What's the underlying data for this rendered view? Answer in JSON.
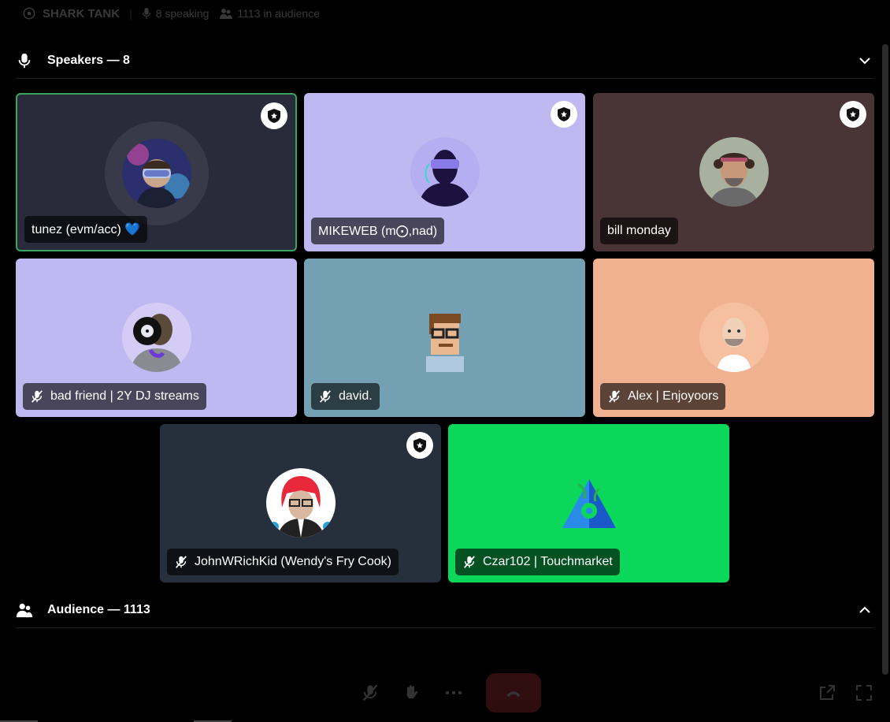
{
  "stage": {
    "title": "SHARK TANK",
    "speaking_text": "8 speaking",
    "audience_text": "1113 in audience"
  },
  "speakers_section": {
    "title": "Speakers — 8",
    "icon": "microphone-icon",
    "chevron": "chevron-down-icon"
  },
  "audience_section": {
    "title": "Audience — 1113",
    "icon": "audience-icon",
    "chevron": "chevron-up-icon"
  },
  "speakers": [
    {
      "name": "tunez (evm/acc) 💙",
      "bg": "#292a3a",
      "moderator": true,
      "muted": false,
      "speaking": true,
      "avatar": "vr-headset-person-avatar"
    },
    {
      "name": "MIKEWEB (m⨀,nad)",
      "bg": "#c0b8f0",
      "moderator": true,
      "muted": false,
      "speaking": false,
      "avatar": "purple-silhouette-avatar"
    },
    {
      "name": "bill monday",
      "bg": "#4a3536",
      "moderator": true,
      "muted": false,
      "speaking": false,
      "avatar": "curly-hair-man-avatar"
    },
    {
      "name": "bad friend | 2Y DJ streams",
      "bg": "#c0b8f0",
      "moderator": false,
      "muted": true,
      "speaking": false,
      "avatar": "vinyl-hoodie-avatar"
    },
    {
      "name": "david.",
      "bg": "#74a0b4",
      "moderator": false,
      "muted": true,
      "speaking": false,
      "avatar": "pixel-man-glasses-avatar"
    },
    {
      "name": "Alex | Enjoyoors",
      "bg": "#efb190",
      "moderator": false,
      "muted": true,
      "speaking": false,
      "avatar": "bald-bearded-cartoon-avatar"
    },
    {
      "name": "JohnWRichKid (Wendy's Fry Cook)",
      "bg": "#25303c",
      "moderator": true,
      "muted": true,
      "speaking": false,
      "avatar": "red-hair-glasses-avatar"
    },
    {
      "name": "Czar102 | Touchmarket",
      "bg": "#0bd85a",
      "moderator": false,
      "muted": true,
      "speaking": false,
      "avatar": "blue-triangle-logo-avatar"
    }
  ],
  "colors": {
    "speaking_border": "#3ba55d",
    "leave_button": "#ed4245"
  },
  "controls": [
    "mute-mic-icon",
    "raise-hand-icon",
    "more-options-icon",
    "leave-stage-icon",
    "popout-icon",
    "fullscreen-icon"
  ]
}
